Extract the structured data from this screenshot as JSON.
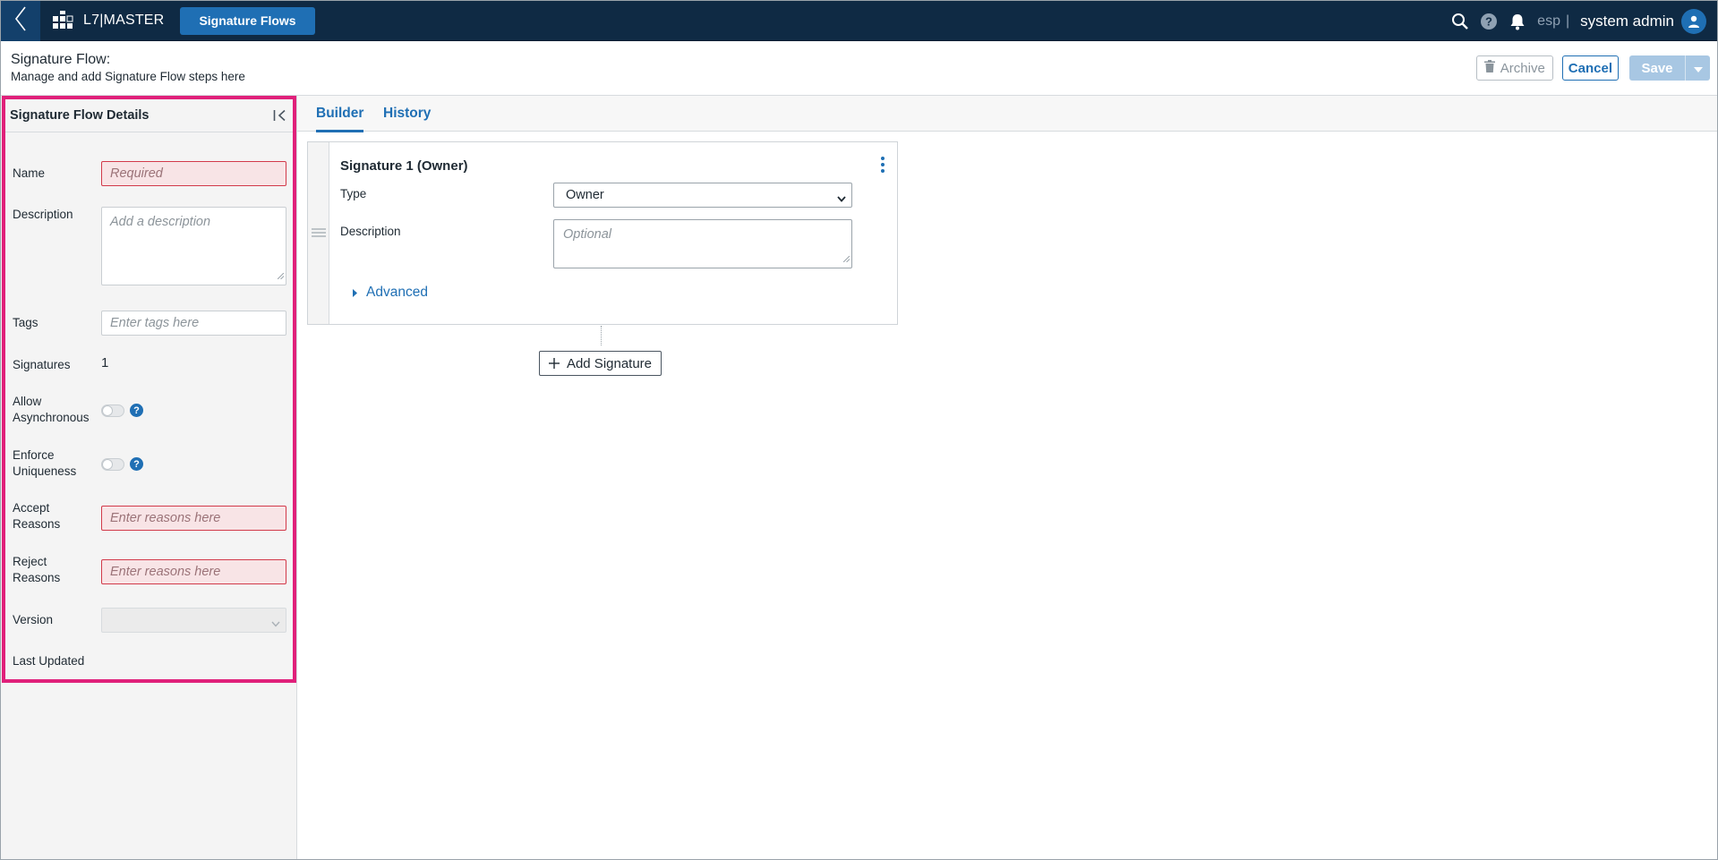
{
  "topbar": {
    "app_title": "L7|MASTER",
    "module_button": "Signature Flows",
    "language": "esp",
    "separator": "|",
    "user_name": "system admin"
  },
  "page_header": {
    "title": "Signature Flow:",
    "subtitle": "Manage and add Signature Flow steps here",
    "archive_label": "Archive",
    "cancel_label": "Cancel",
    "save_label": "Save"
  },
  "details_panel": {
    "title": "Signature Flow Details",
    "fields": {
      "name": {
        "label": "Name",
        "placeholder": "Required"
      },
      "description": {
        "label": "Description",
        "placeholder": "Add a description"
      },
      "tags": {
        "label": "Tags",
        "placeholder": "Enter tags here"
      },
      "signatures": {
        "label": "Signatures",
        "value": "1"
      },
      "allow_async": {
        "label_1": "Allow",
        "label_2": "Asynchronous",
        "enabled": false
      },
      "enforce_uniqueness": {
        "label_1": "Enforce",
        "label_2": "Uniqueness",
        "enabled": false
      },
      "accept_reasons": {
        "label_1": "Accept",
        "label_2": "Reasons",
        "placeholder": "Enter reasons here"
      },
      "reject_reasons": {
        "label_1": "Reject",
        "label_2": "Reasons",
        "placeholder": "Enter reasons here"
      },
      "version": {
        "label": "Version",
        "value": ""
      },
      "last_updated": {
        "label": "Last Updated",
        "value": ""
      }
    },
    "help_glyph": "?"
  },
  "tabs": [
    {
      "label": "Builder",
      "active": true
    },
    {
      "label": "History",
      "active": false
    }
  ],
  "signature_card": {
    "title": "Signature 1 (Owner)",
    "type_label": "Type",
    "type_value": "Owner",
    "description_label": "Description",
    "description_placeholder": "Optional",
    "advanced_label": "Advanced"
  },
  "add_signature_label": "Add Signature",
  "colors": {
    "topbar_bg": "#0f2a44",
    "accent": "#1f6fb4",
    "highlight": "#e0207a",
    "required_bg": "#f8e4e6"
  },
  "icons": [
    "back-chevron-icon",
    "app-grid-icon",
    "search-icon",
    "help-icon",
    "bell-icon",
    "user-icon",
    "trash-icon",
    "collapse-panel-icon",
    "kebab-menu-icon",
    "drag-handle-icon",
    "caret-right-icon",
    "plus-icon"
  ]
}
